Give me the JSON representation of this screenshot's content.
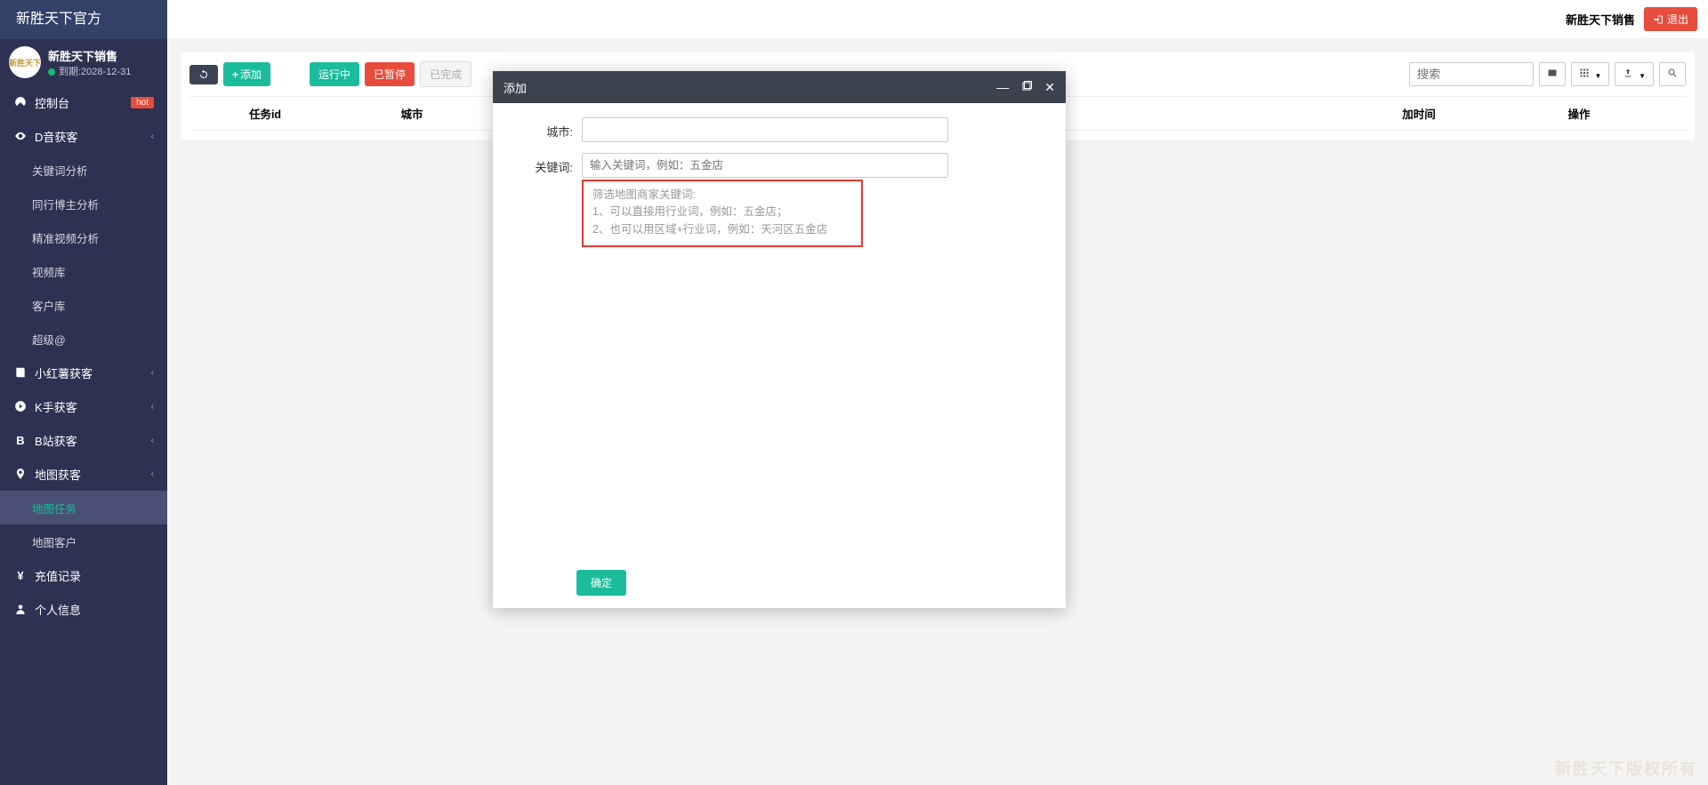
{
  "brand": "新胜天下官方",
  "user": {
    "name": "新胜天下销售",
    "expiry": "到期:2028-12-31",
    "avatar_text": "新胜天下"
  },
  "top": {
    "user_label": "新胜天下销售",
    "logout": "退出"
  },
  "nav": {
    "console": "控制台",
    "hot": "hot",
    "dyin": "D音获客",
    "d1": "关键词分析",
    "d2": "同行博主分析",
    "d3": "精准视频分析",
    "d4": "视频库",
    "d5": "客户库",
    "d6": "超级@",
    "xhs": "小红薯获客",
    "ks": "K手获客",
    "bz": "B站获客",
    "map": "地图获客",
    "m1": "地图任务",
    "m2": "地图客户",
    "recharge": "充值记录",
    "profile": "个人信息"
  },
  "toolbar": {
    "add": "添加",
    "running": "运行中",
    "paused": "已暂停",
    "done": "已完成",
    "search_ph": "搜索"
  },
  "table": {
    "cols": [
      "任务id",
      "城市",
      "加时间",
      "操作"
    ]
  },
  "modal": {
    "title": "添加",
    "city_label": "城市:",
    "kw_label": "关键词:",
    "kw_ph": "输入关键词，例如：五金店",
    "hint_t": "筛选地图商家关键词:",
    "hint_1": "1、可以直接用行业词，例如：五金店；",
    "hint_2": "2、也可以用区域+行业词，例如：天河区五金店",
    "ok": "确定"
  },
  "watermark": "新胜天下版权所有"
}
